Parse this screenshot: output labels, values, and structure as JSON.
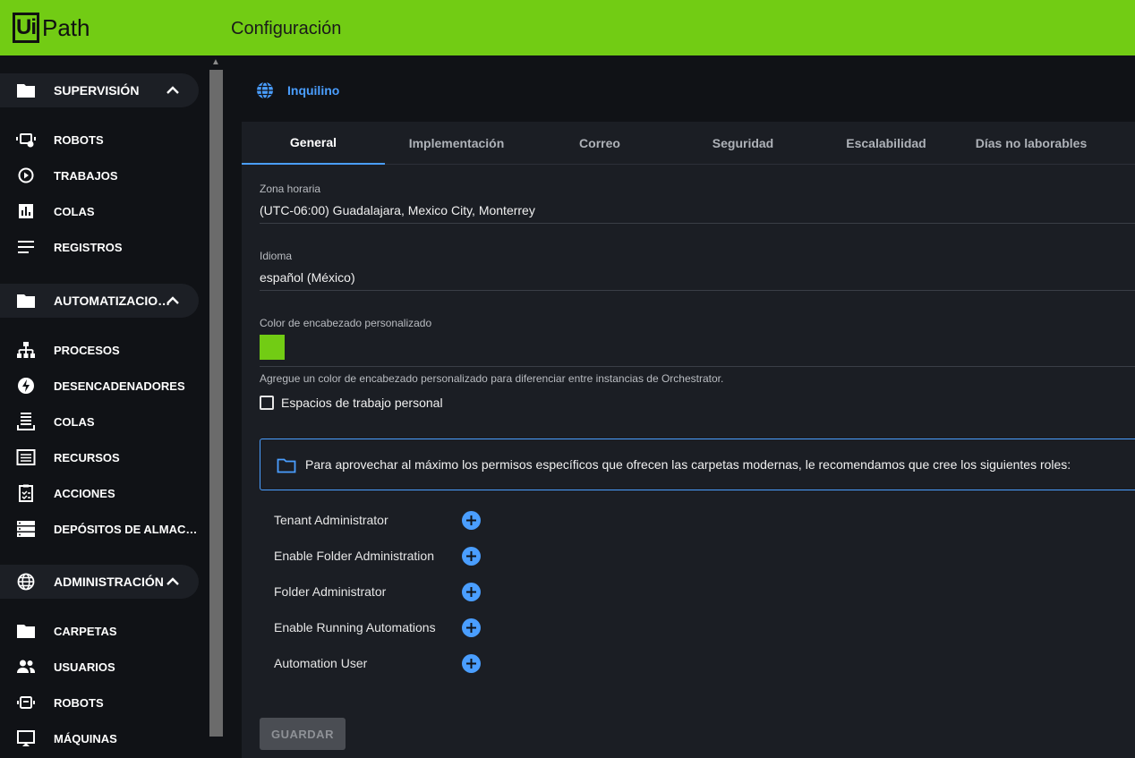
{
  "header": {
    "logo_box": "Ui",
    "logo_text": "Path",
    "title": "Configuración",
    "color": "#72cc14"
  },
  "sidebar": {
    "sections": [
      {
        "label": "SUPERVISIÓN",
        "icon": "folder-icon",
        "items": [
          {
            "label": "ROBOTS",
            "icon": "robot-monitor-icon"
          },
          {
            "label": "TRABAJOS",
            "icon": "play-circle-icon"
          },
          {
            "label": "COLAS",
            "icon": "bar-chart-icon"
          },
          {
            "label": "REGISTROS",
            "icon": "lines-icon"
          }
        ]
      },
      {
        "label": "AUTOMATIZACIO…",
        "icon": "folder-icon",
        "items": [
          {
            "label": "PROCESOS",
            "icon": "hierarchy-icon"
          },
          {
            "label": "DESENCADENADORES",
            "icon": "bolt-icon"
          },
          {
            "label": "COLAS",
            "icon": "queue-stack-icon"
          },
          {
            "label": "RECURSOS",
            "icon": "asset-list-icon"
          },
          {
            "label": "ACCIONES",
            "icon": "clipboard-check-icon"
          },
          {
            "label": "DEPÓSITOS DE ALMAC…",
            "icon": "storage-icon"
          }
        ]
      },
      {
        "label": "ADMINISTRACIÓN",
        "icon": "globe-icon",
        "items": [
          {
            "label": "CARPETAS",
            "icon": "folder-icon"
          },
          {
            "label": "USUARIOS",
            "icon": "users-icon"
          },
          {
            "label": "ROBOTS",
            "icon": "robot-icon"
          },
          {
            "label": "MÁQUINAS",
            "icon": "machine-icon"
          }
        ]
      }
    ]
  },
  "main": {
    "tenant_label": "Inquilino",
    "tabs": [
      {
        "label": "General",
        "active": true
      },
      {
        "label": "Implementación"
      },
      {
        "label": "Correo"
      },
      {
        "label": "Seguridad"
      },
      {
        "label": "Escalabilidad"
      },
      {
        "label": "Días no laborables"
      }
    ],
    "timezone": {
      "caption": "Zona horaria",
      "value": "(UTC-06:00) Guadalajara, Mexico City, Monterrey"
    },
    "language": {
      "caption": "Idioma",
      "value": "español (México)"
    },
    "header_color": {
      "caption": "Color de encabezado personalizado",
      "value": "#72cc14",
      "hint": "Agregue un color de encabezado personalizado para diferenciar entre instancias de Orchestrator."
    },
    "personal_workspaces": {
      "label": "Espacios de trabajo personal",
      "checked": false
    },
    "info_text": "Para aprovechar al máximo los permisos específicos que ofrecen las carpetas modernas, le recomendamos que cree los siguientes roles:",
    "roles": [
      "Tenant Administrator",
      "Enable Folder Administration",
      "Folder Administrator",
      "Enable Running Automations",
      "Automation User"
    ],
    "save_label": "GUARDAR",
    "accent_color": "#4a9eff"
  }
}
